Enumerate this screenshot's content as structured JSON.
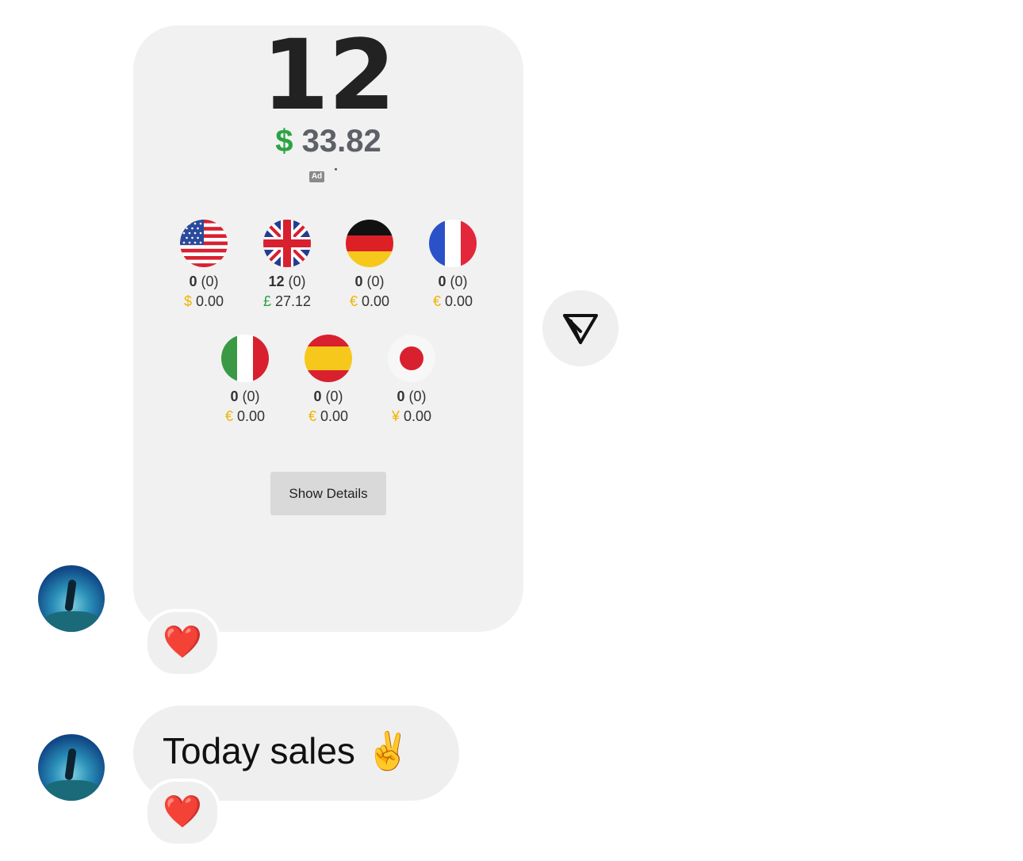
{
  "card": {
    "count": "12",
    "total_symbol": "$",
    "total_value": "33.82",
    "ad_label": "Ad",
    "show_details_label": "Show Details",
    "markets": [
      {
        "flag": "us-flag-icon",
        "count": "0",
        "pending": "(0)",
        "symbol": "$",
        "amount": "0.00"
      },
      {
        "flag": "uk-flag-icon",
        "count": "12",
        "pending": "(0)",
        "symbol": "£",
        "amount": "27.12"
      },
      {
        "flag": "de-flag-icon",
        "count": "0",
        "pending": "(0)",
        "symbol": "€",
        "amount": "0.00"
      },
      {
        "flag": "fr-flag-icon",
        "count": "0",
        "pending": "(0)",
        "symbol": "€",
        "amount": "0.00"
      },
      {
        "flag": "it-flag-icon",
        "count": "0",
        "pending": "(0)",
        "symbol": "€",
        "amount": "0.00"
      },
      {
        "flag": "es-flag-icon",
        "count": "0",
        "pending": "(0)",
        "symbol": "€",
        "amount": "0.00"
      },
      {
        "flag": "jp-flag-icon",
        "count": "0",
        "pending": "(0)",
        "symbol": "¥",
        "amount": "0.00"
      }
    ]
  },
  "reactions": {
    "first": "❤️",
    "second": "❤️"
  },
  "message": {
    "text": "Today sales",
    "emoji": "✌️"
  },
  "colors": {
    "accent_green": "#2aa343",
    "currency_gold": "#f0b400",
    "bubble_bg": "#f1f1f1"
  },
  "icons": {
    "share": "paper-plane-icon",
    "avatar": "profile-avatar"
  }
}
